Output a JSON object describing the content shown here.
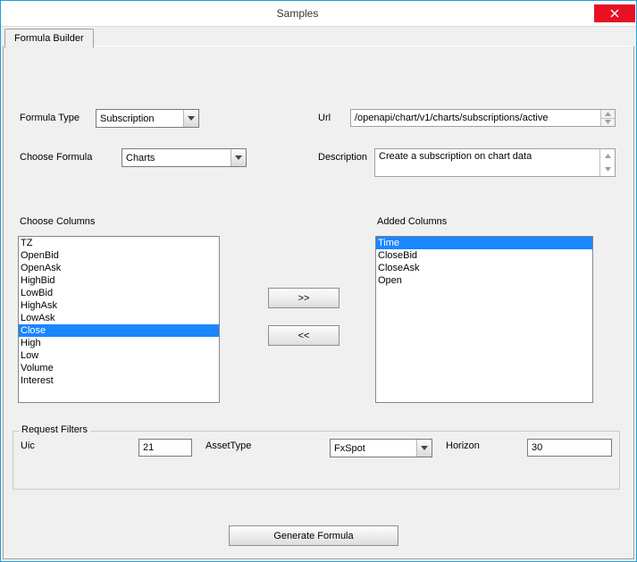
{
  "window": {
    "title": "Samples"
  },
  "tabs": {
    "formulaBuilder": "Formula Builder"
  },
  "labels": {
    "formulaType": "Formula Type",
    "url": "Url",
    "chooseFormula": "Choose Formula",
    "description": "Description",
    "chooseColumns": "Choose Columns",
    "addedColumns": "Added Columns",
    "requestFilters": "Request Filters",
    "uic": "Uic",
    "assetType": "AssetType",
    "horizon": "Horizon"
  },
  "fields": {
    "formulaType": "Subscription",
    "chooseFormula": "Charts",
    "url": "/openapi/chart/v1/charts/subscriptions/active",
    "description": "Create a subscription on chart data",
    "uic": "21",
    "assetType": "FxSpot",
    "horizon": "30"
  },
  "buttons": {
    "moveRight": ">>",
    "moveLeft": "<<",
    "generate": "Generate Formula"
  },
  "chooseColumns": {
    "items": [
      "TZ",
      "OpenBid",
      "OpenAsk",
      "HighBid",
      "LowBid",
      "HighAsk",
      "LowAsk",
      "Close",
      "High",
      "Low",
      "Volume",
      "Interest"
    ],
    "selectedIndex": 7
  },
  "addedColumns": {
    "items": [
      "Time",
      "CloseBid",
      "CloseAsk",
      "Open"
    ],
    "selectedIndex": 0
  }
}
